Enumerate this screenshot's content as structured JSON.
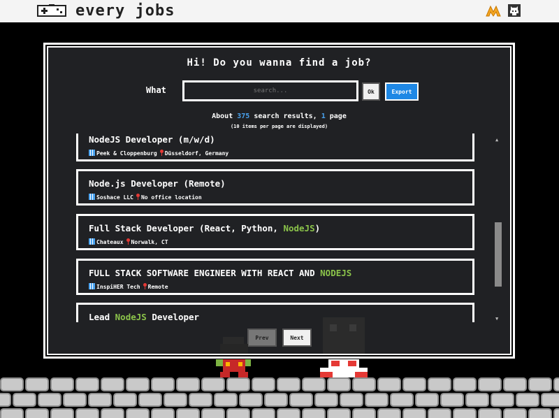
{
  "header": {
    "brand": "every jobs",
    "icons": [
      "gamepad-icon",
      "m-logo-icon",
      "github-icon"
    ]
  },
  "search": {
    "title": "Hi! Do you wanna find a job?",
    "what_label": "What",
    "placeholder": "search...",
    "value": "",
    "ok_label": "Ok",
    "export_label": "Export"
  },
  "summary": {
    "about": "About",
    "count": "375",
    "mid": "search results,",
    "pages": "1",
    "page_word": "page",
    "sub": "(10 items per page are displayed)"
  },
  "results": [
    {
      "title_parts": [
        {
          "text": "NodeJS Developer (m/w/d)",
          "hl": false
        }
      ],
      "company": "Peek & Cloppenburg",
      "location": "Düsseldorf, Germany"
    },
    {
      "title_parts": [
        {
          "text": "Node.js Developer (Remote)",
          "hl": false
        }
      ],
      "company": "Soshace LLC",
      "location": "No office location"
    },
    {
      "title_parts": [
        {
          "text": "Full Stack Developer (React, Python, ",
          "hl": false
        },
        {
          "text": "NodeJS",
          "hl": true
        },
        {
          "text": ")",
          "hl": false
        }
      ],
      "company": "Chateaux",
      "location": "Norwalk, CT"
    },
    {
      "title_parts": [
        {
          "text": "FULL STACK SOFTWARE ENGINEER WITH REACT AND ",
          "hl": false
        },
        {
          "text": "NODEJS",
          "hl": true
        }
      ],
      "company": "InspiHER Tech",
      "location": "Remote"
    },
    {
      "title_parts": [
        {
          "text": "Lead ",
          "hl": false
        },
        {
          "text": "NodeJS",
          "hl": true
        },
        {
          "text": " Developer",
          "hl": false
        }
      ],
      "company": "",
      "location": ""
    }
  ],
  "pager": {
    "prev_label": "Prev",
    "next_label": "Next"
  },
  "colors": {
    "highlight": "#8bc34a",
    "count": "#4aa3f0",
    "export": "#1e88e5",
    "panel": "#202124"
  }
}
